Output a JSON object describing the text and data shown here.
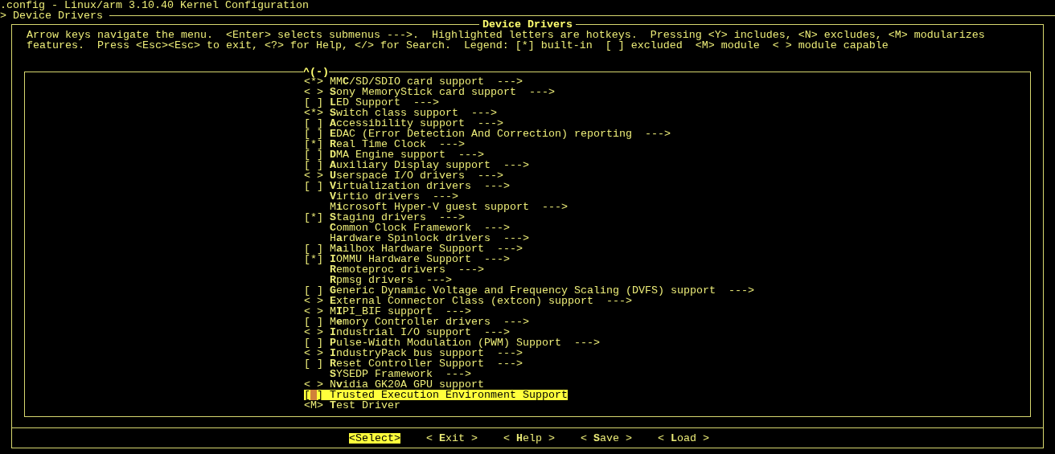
{
  "header": {
    "title": ".config - Linux/arm 3.10.40 Kernel Configuration",
    "breadcrumb": "> Device Drivers"
  },
  "dialog": {
    "title": "Device Drivers",
    "help": [
      "Arrow keys navigate the menu.  <Enter> selects submenus --->.  Highlighted letters are hotkeys.  Pressing <Y> includes, <N> excludes, <M> modularizes",
      "features.  Press <Esc><Esc> to exit, <?> for Help, </> for Search.  Legend: [*] built-in  [ ] excluded  <M> module  < > module capable"
    ],
    "scroll_indicator": "^(-)",
    "items": [
      {
        "prefix": "<*>",
        "label": "MM**C**/SD/SDIO card support",
        "arrow": "--->",
        "selected": false
      },
      {
        "prefix": "< >",
        "label": "**S**ony MemoryStick card support",
        "arrow": "--->",
        "selected": false
      },
      {
        "prefix": "[ ]",
        "label": "**L**ED Support",
        "arrow": "--->",
        "selected": false
      },
      {
        "prefix": "<*>",
        "label": "**S**witch class support",
        "arrow": "--->",
        "selected": false
      },
      {
        "prefix": "[ ]",
        "label": "**A**ccessibility support",
        "arrow": "--->",
        "selected": false
      },
      {
        "prefix": "[ ]",
        "label": "**E**DAC (Error Detection And Correction) reporting",
        "arrow": "--->",
        "selected": false
      },
      {
        "prefix": "[*]",
        "label": "**R**eal Time Clock",
        "arrow": "--->",
        "selected": false
      },
      {
        "prefix": "[ ]",
        "label": "**D**MA Engine support",
        "arrow": "--->",
        "selected": false
      },
      {
        "prefix": "[ ]",
        "label": "**A**uxiliary Display support",
        "arrow": "--->",
        "selected": false
      },
      {
        "prefix": "< >",
        "label": "**U**serspace I/O drivers",
        "arrow": "--->",
        "selected": false
      },
      {
        "prefix": "[ ]",
        "label": "**V**irtualization drivers",
        "arrow": "--->",
        "selected": false
      },
      {
        "label": "**V**irtio drivers",
        "arrow": "--->",
        "selected": false
      },
      {
        "label": "M**i**crosoft Hyper-V guest support",
        "arrow": "--->",
        "selected": false
      },
      {
        "prefix": "[*]",
        "label": "**S**taging drivers",
        "arrow": "--->",
        "selected": false
      },
      {
        "label": "**C**ommon Clock Framework",
        "arrow": "--->",
        "selected": false
      },
      {
        "label": "H**a**rdware Spinlock drivers",
        "arrow": "--->",
        "selected": false
      },
      {
        "prefix": "[ ]",
        "label": "M**a**ilbox Hardware Support",
        "arrow": "--->",
        "selected": false
      },
      {
        "prefix": "[*]",
        "label": "**I**OMMU Hardware Support",
        "arrow": "--->",
        "selected": false
      },
      {
        "label": "**R**emoteproc drivers",
        "arrow": "--->",
        "selected": false
      },
      {
        "label": "**R**pmsg drivers",
        "arrow": "--->",
        "selected": false
      },
      {
        "prefix": "[ ]",
        "label": "**G**eneric Dynamic Voltage and Frequency Scaling (DVFS) support",
        "arrow": "--->",
        "selected": false
      },
      {
        "prefix": "< >",
        "label": "**E**xternal Connector Class (extcon) support",
        "arrow": "--->",
        "selected": false
      },
      {
        "prefix": "< >",
        "label": "M**I**PI_BIF support",
        "arrow": "--->",
        "selected": false
      },
      {
        "prefix": "[ ]",
        "label": "M**e**mory Controller drivers",
        "arrow": "--->",
        "selected": false
      },
      {
        "prefix": "< >",
        "label": "**I**ndustrial I/O support",
        "arrow": "--->",
        "selected": false
      },
      {
        "prefix": "[ ]",
        "label": "**P**ulse-Width Modulation (PWM) Support",
        "arrow": "--->",
        "selected": false
      },
      {
        "prefix": "< >",
        "label": "**I**ndustryPack bus support",
        "arrow": "--->",
        "selected": false
      },
      {
        "prefix": "[ ]",
        "label": "**R**eset Controller Support",
        "arrow": "--->",
        "selected": false
      },
      {
        "label": "**S**YSEDP Framework",
        "arrow": "--->",
        "selected": false
      },
      {
        "prefix": "< >",
        "label": "N**v**idia GK20A GPU support",
        "selected": false
      },
      {
        "prefix": "[ ]",
        "label": "Trusted Execution Environment Support",
        "selected": true
      },
      {
        "prefix": "<M>",
        "label": "**T**est Driver",
        "selected": false
      }
    ],
    "buttons": [
      {
        "label": "<Select>",
        "selected": true
      },
      {
        "label": "< **E**xit >",
        "selected": false
      },
      {
        "label": "< **H**elp >",
        "selected": false
      },
      {
        "label": "< **S**ave >",
        "selected": false
      },
      {
        "label": "< **L**oad >",
        "selected": false
      }
    ]
  }
}
